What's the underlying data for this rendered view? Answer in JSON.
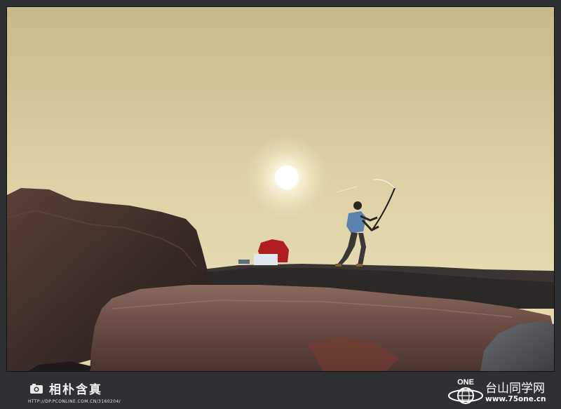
{
  "photo": {
    "subject": "angler-casting-fishing-rod",
    "sky_color": "#d8c89a",
    "sun_color": "#ffffff"
  },
  "watermark_left": {
    "title": "相朴含真",
    "url": "HTTP://DP.PCONLINE.COM.CN/3160204/"
  },
  "watermark_right": {
    "logo_text": "ONE",
    "site_name": "台山同学网",
    "site_url": "www.75one.cn"
  }
}
